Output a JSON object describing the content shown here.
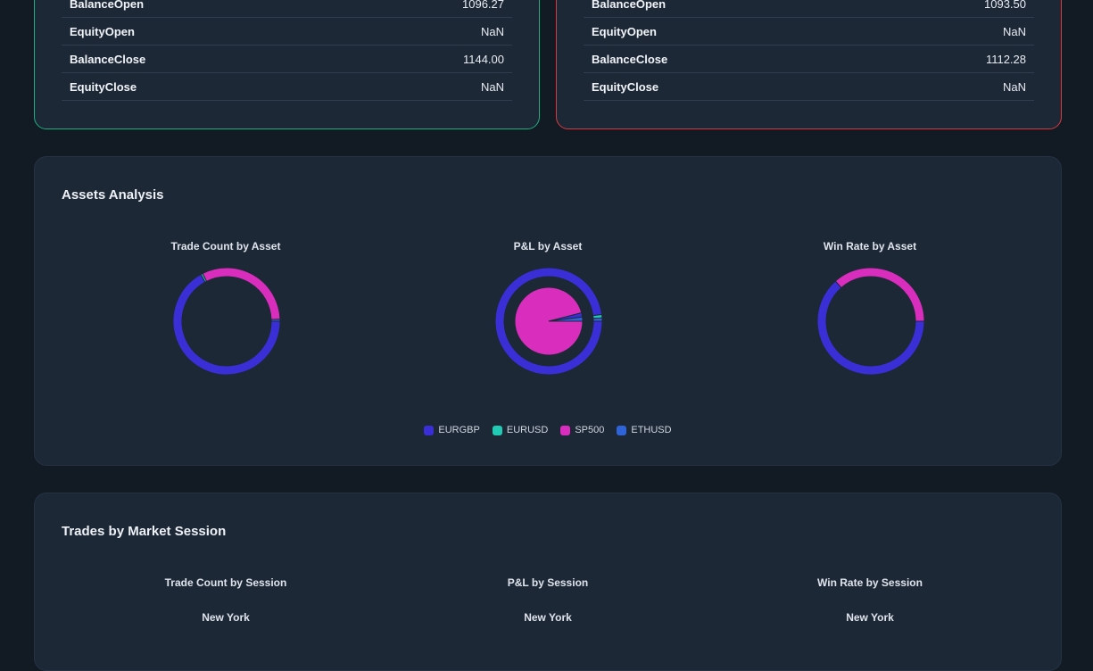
{
  "account_left": {
    "rows": [
      {
        "label": "BalanceOpen",
        "value": "1096.27"
      },
      {
        "label": "EquityOpen",
        "value": "NaN"
      },
      {
        "label": "BalanceClose",
        "value": "1144.00"
      },
      {
        "label": "EquityClose",
        "value": "NaN"
      }
    ],
    "border_color": "#1fae7e"
  },
  "account_right": {
    "rows": [
      {
        "label": "BalanceOpen",
        "value": "1093.50"
      },
      {
        "label": "EquityOpen",
        "value": "NaN"
      },
      {
        "label": "BalanceClose",
        "value": "1112.28"
      },
      {
        "label": "EquityClose",
        "value": "NaN"
      }
    ],
    "border_color": "#d8393f"
  },
  "assets": {
    "title": "Assets Analysis",
    "charts": [
      {
        "title": "Trade Count by Asset"
      },
      {
        "title": "P&L by Asset"
      },
      {
        "title": "Win Rate by Asset"
      }
    ],
    "legend": [
      {
        "label": "EURGBP",
        "color": "#3a2fd6"
      },
      {
        "label": "EURUSD",
        "color": "#22c9b4"
      },
      {
        "label": "SP500",
        "color": "#d92ebd"
      },
      {
        "label": "ETHUSD",
        "color": "#2f63d8"
      }
    ]
  },
  "sessions": {
    "title": "Trades by Market Session",
    "charts": [
      {
        "title": "Trade Count by Session",
        "label": "New York"
      },
      {
        "title": "P&L by Session",
        "label": "New York"
      },
      {
        "title": "Win Rate by Session",
        "label": "New York"
      }
    ]
  },
  "chart_data": [
    {
      "type": "pie",
      "title": "Trade Count by Asset",
      "categories": [
        "EURGBP",
        "EURUSD",
        "SP500",
        "ETHUSD"
      ],
      "values": [
        67,
        0.6,
        31.8,
        0.6
      ]
    },
    {
      "type": "pie",
      "title": "P&L by Asset",
      "categories": [
        "EURGBP",
        "EURUSD",
        "SP500",
        "ETHUSD"
      ],
      "values": [
        98,
        1,
        0,
        1
      ]
    },
    {
      "type": "pie",
      "title": "Win Rate by Asset",
      "categories": [
        "EURGBP",
        "EURUSD",
        "SP500",
        "ETHUSD"
      ],
      "values": [
        63.5,
        0,
        36.5,
        0
      ]
    }
  ]
}
